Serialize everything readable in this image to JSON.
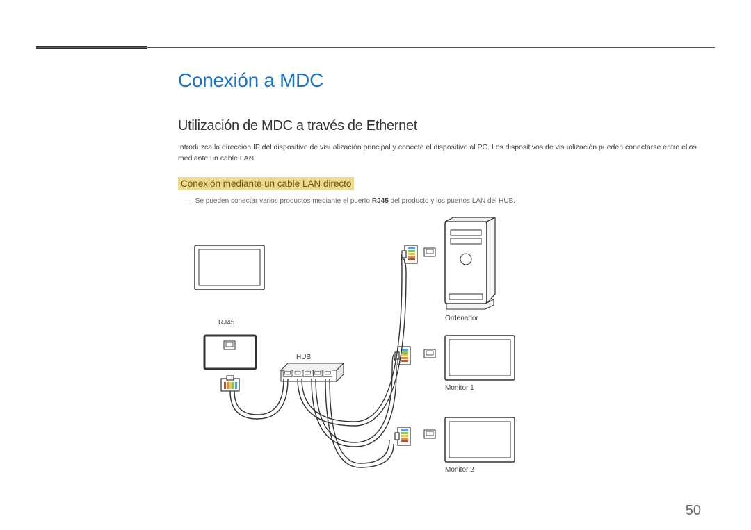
{
  "headings": {
    "h1": "Conexión a MDC",
    "h2": "Utilización de MDC a través de Ethernet",
    "h3": "Conexión mediante un cable LAN directo"
  },
  "paragraphs": {
    "intro": "Introduzca la dirección IP del dispositivo de visualización principal y conecte el dispositivo al PC. Los dispositivos de visualización pueden conectarse entre ellos mediante un cable LAN.",
    "note_prefix": "―",
    "note_a": "Se pueden conectar varios productos mediante el puerto ",
    "note_bold": "RJ45",
    "note_b": " del producto y los puertos LAN del HUB."
  },
  "diagram_labels": {
    "rj45": "RJ45",
    "hub": "HUB",
    "computer": "Ordenador",
    "monitor1": "Monitor 1",
    "monitor2": "Monitor 2"
  },
  "page_number": "50"
}
